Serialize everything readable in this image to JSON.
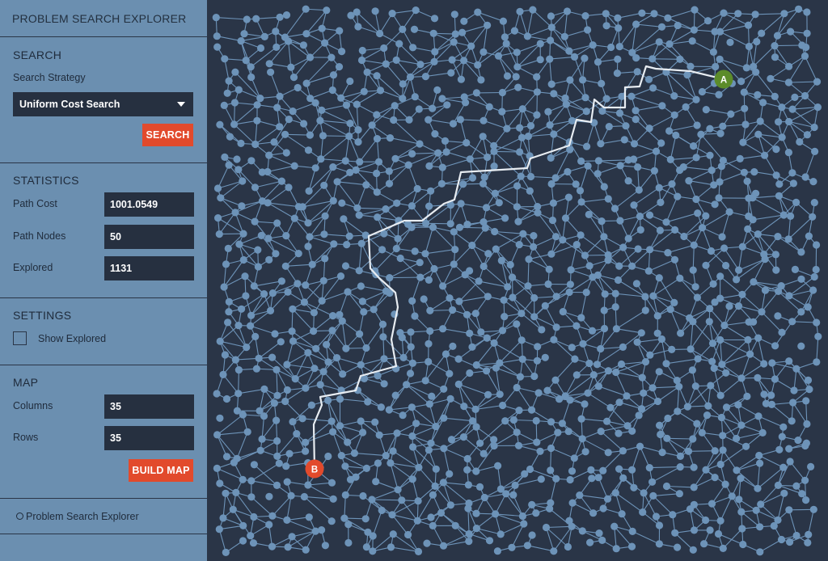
{
  "app": {
    "title": "PROBLEM SEARCH EXPLORER"
  },
  "search": {
    "heading": "SEARCH",
    "strategy_label": "Search Strategy",
    "strategy_value": "Uniform Cost Search",
    "button": "SEARCH"
  },
  "statistics": {
    "heading": "STATISTICS",
    "path_cost_label": "Path Cost",
    "path_cost_value": "1001.0549",
    "path_nodes_label": "Path Nodes",
    "path_nodes_value": "50",
    "explored_label": "Explored",
    "explored_value": "1131"
  },
  "settings": {
    "heading": "SETTINGS",
    "show_explored_label": "Show Explored",
    "show_explored_checked": false
  },
  "map_settings": {
    "heading": "MAP",
    "columns_label": "Columns",
    "columns_value": "35",
    "rows_label": "Rows",
    "rows_value": "35",
    "button": "BUILD MAP"
  },
  "footer": {
    "link_text": "Problem Search Explorer",
    "icon": "github-icon"
  },
  "graph": {
    "columns": 35,
    "rows": 35,
    "start_label": "A",
    "goal_label": "B",
    "colors": {
      "background": "#2a3547",
      "node": "#6d93b8",
      "edge": "#6d93b8",
      "path": "#e8edf2",
      "start": "#5c8c2a",
      "goal": "#e24a2c",
      "sidebar": "#6b8fb0",
      "accent": "#e24a2c"
    }
  }
}
